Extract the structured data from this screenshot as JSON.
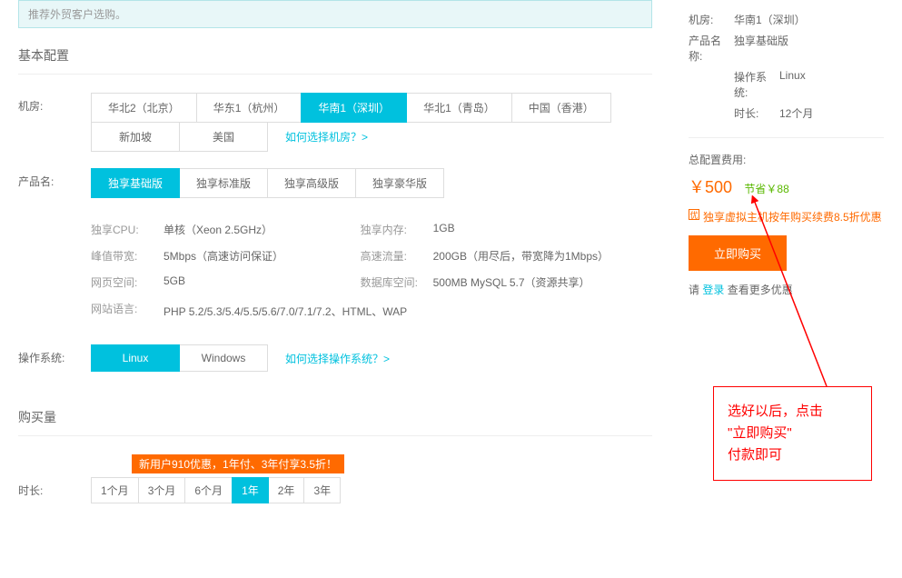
{
  "notice": "推荐外贸客户选购。",
  "sections": {
    "basic": "基本配置",
    "quantity": "购买量"
  },
  "labels": {
    "location": "机房:",
    "product": "产品名:",
    "os": "操作系统:",
    "duration": "时长:"
  },
  "locations": {
    "row1": [
      "华北2（北京）",
      "华东1（杭州）",
      "华南1（深圳）",
      "华北1（青岛）",
      "中国（香港）"
    ],
    "row2": [
      "新加坡",
      "美国"
    ],
    "help": "如何选择机房？>"
  },
  "products": [
    "独享基础版",
    "独享标准版",
    "独享高级版",
    "独享豪华版"
  ],
  "specs": {
    "cpu_label": "独享CPU:",
    "cpu_value": "单核（Xeon 2.5GHz）",
    "mem_label": "独享内存:",
    "mem_value": "1GB",
    "bw_label": "峰值带宽:",
    "bw_value": "5Mbps（高速访问保证）",
    "traffic_label": "高速流量:",
    "traffic_value": "200GB（用尽后，带宽降为1Mbps）",
    "web_label": "网页空间:",
    "web_value": "5GB",
    "db_label": "数据库空间:",
    "db_value": "500MB MySQL 5.7（资源共享）",
    "lang_label": "网站语言:",
    "lang_value": "PHP 5.2/5.3/5.4/5.5/5.6/7.0/7.1/7.2、HTML、WAP"
  },
  "os": {
    "options": [
      "Linux",
      "Windows"
    ],
    "help": "如何选择操作系统？>"
  },
  "duration": {
    "promo": "新用户910优惠，1年付、3年付享3.5折！",
    "options": [
      "1个月",
      "3个月",
      "6个月",
      "1年",
      "2年",
      "3年"
    ]
  },
  "summary": {
    "location_label": "机房:",
    "location_value": "华南1（深圳）",
    "product_label": "产品名称:",
    "product_value": "独享基础版",
    "os_label": "操作系统:",
    "os_value": "Linux",
    "duration_label": "时长:",
    "duration_value": "12个月"
  },
  "pricing": {
    "total_label": "总配置费用:",
    "amount": "￥500",
    "save": "节省￥88",
    "promo": "独享虚拟主机按年购买续费8.5折优惠",
    "buy_button": "立即购买",
    "login_prefix": "请 ",
    "login_link": "登录",
    "login_suffix": " 查看更多优惠"
  },
  "annotation": {
    "line1": "选好以后，点击",
    "line2": "\"立即购买\"",
    "line3": "付款即可"
  }
}
